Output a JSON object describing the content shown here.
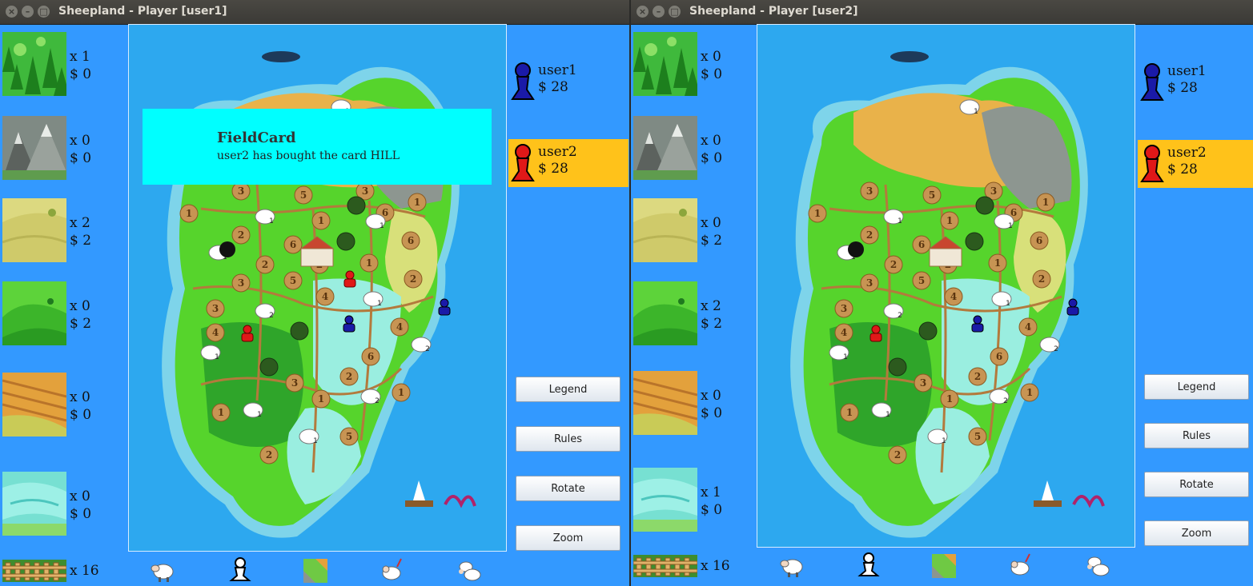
{
  "windows": [
    {
      "title": "Sheepland - Player [user1]",
      "cards": [
        {
          "terrain": "forest",
          "count": "x 1",
          "price": "$ 0"
        },
        {
          "terrain": "mountain",
          "count": "x 0",
          "price": "$ 0"
        },
        {
          "terrain": "plain",
          "count": "x 2",
          "price": "$ 2"
        },
        {
          "terrain": "hill",
          "count": "x 0",
          "price": "$ 2"
        },
        {
          "terrain": "field",
          "count": "x 0",
          "price": "$ 0"
        },
        {
          "terrain": "lake",
          "count": "x 0",
          "price": "$ 0"
        }
      ],
      "fences": "x 16",
      "players": [
        {
          "name": "user1",
          "money": "$ 28",
          "color": "#1a1aa8",
          "active": false
        },
        {
          "name": "user2",
          "money": "$ 28",
          "color": "#e01818",
          "active": true
        }
      ],
      "buttons": [
        "Legend",
        "Rules",
        "Rotate",
        "Zoom"
      ],
      "notification": {
        "title": "FieldCard",
        "message": "user2 has bought the card HILL"
      }
    },
    {
      "title": "Sheepland - Player [user2]",
      "cards": [
        {
          "terrain": "forest",
          "count": "x 0",
          "price": "$ 0"
        },
        {
          "terrain": "mountain",
          "count": "x 0",
          "price": "$ 0"
        },
        {
          "terrain": "plain",
          "count": "x 0",
          "price": "$ 2"
        },
        {
          "terrain": "hill",
          "count": "x 2",
          "price": "$ 2"
        },
        {
          "terrain": "field",
          "count": "x 0",
          "price": "$ 0"
        },
        {
          "terrain": "lake",
          "count": "x 1",
          "price": "$ 0"
        }
      ],
      "fences": "x 16",
      "players": [
        {
          "name": "user1",
          "money": "$ 28",
          "color": "#1a1aa8",
          "active": false
        },
        {
          "name": "user2",
          "money": "$ 28",
          "color": "#e01818",
          "active": true
        }
      ],
      "buttons": [
        "Legend",
        "Rules",
        "Rotate",
        "Zoom"
      ]
    }
  ],
  "board": {
    "region_numbers": [
      "1",
      "3",
      "5",
      "3",
      "1",
      "6",
      "1",
      "2",
      "6",
      "1",
      "3",
      "2",
      "5",
      "4",
      "2",
      "3",
      "4",
      "6",
      "4",
      "2",
      "3",
      "1",
      "1",
      "5",
      "2",
      "1",
      "2",
      "6"
    ],
    "sheep_counts": [
      "1",
      "1",
      "1",
      "2",
      "2",
      "1",
      "1",
      "2",
      "1",
      "1",
      "1"
    ]
  },
  "bottom_toolbar": [
    "sheep-icon",
    "shepherd-icon",
    "card-icon",
    "ram-icon",
    "lamb-icon"
  ],
  "colors": {
    "background": "#3399ff",
    "active_player": "#ffc21a",
    "notification": "#00ffff",
    "sea": "#2da8ef"
  }
}
